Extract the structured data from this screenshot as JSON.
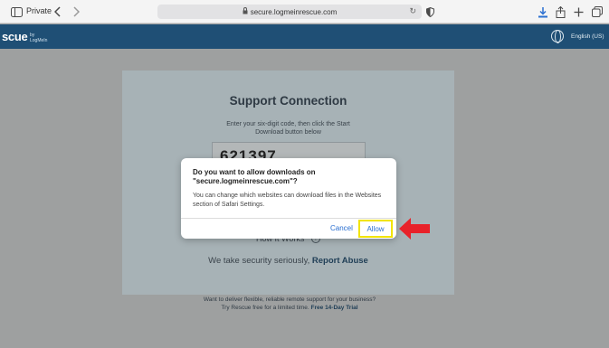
{
  "browser": {
    "private_label": "Private",
    "url": "secure.logmeinrescue.com"
  },
  "site": {
    "brand": "scue",
    "brand_by": "by",
    "brand_logme": "LogMeIn",
    "language": "English (US)"
  },
  "card": {
    "title": "Support Connection",
    "instruction": "Enter your six-digit code, then click the Start Download button below",
    "code": "621397",
    "how_it_works": "How It Works",
    "security_text": "We take security seriously, ",
    "report_abuse": "Report Abuse"
  },
  "footer": {
    "line1": "Want to deliver flexible, reliable remote support for your business?",
    "line2": "Try Rescue free for a limited time. ",
    "free_trial": "Free 14-Day Trial"
  },
  "dialog": {
    "title": "Do you want to allow downloads on \"secure.logmeinrescue.com\"?",
    "body": "You can change which websites can download files in the Websites section of Safari Settings.",
    "cancel_label": "Cancel",
    "allow_label": "Allow"
  },
  "colors": {
    "header_bar": "#1f4f75",
    "highlight": "#f2e400",
    "arrow": "#e8222a",
    "link_blue": "#2a6fd1"
  }
}
